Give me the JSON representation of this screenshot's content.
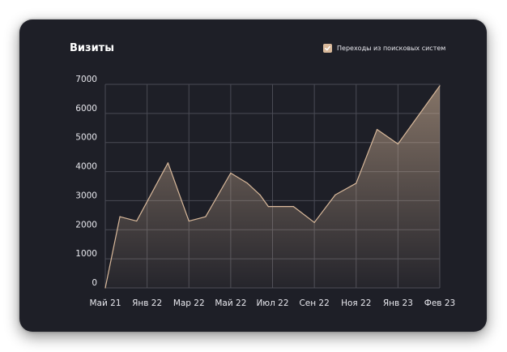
{
  "chart_data": {
    "type": "area",
    "title": "Визиты",
    "xlabel": "",
    "ylabel": "",
    "ylim": [
      0,
      7000
    ],
    "y_ticks": [
      0,
      1000,
      2000,
      3000,
      4000,
      5000,
      6000,
      7000
    ],
    "grid": true,
    "legend_placement": "top-right",
    "categories": [
      "Май 21",
      "Янв 22",
      "Мар 22",
      "Май 22",
      "Июл 22",
      "Сен 22",
      "Ноя 22",
      "Янв 23",
      "Фев 23"
    ],
    "series": [
      {
        "name": "Переходы из поисковых систем",
        "color": "#d9b99b",
        "points": [
          [
            0.0,
            0
          ],
          [
            0.35,
            2450
          ],
          [
            0.75,
            2300
          ],
          [
            1.5,
            4300
          ],
          [
            2.0,
            2300
          ],
          [
            2.4,
            2450
          ],
          [
            3.0,
            3950
          ],
          [
            3.4,
            3600
          ],
          [
            3.7,
            3200
          ],
          [
            3.9,
            2800
          ],
          [
            4.5,
            2800
          ],
          [
            5.0,
            2250
          ],
          [
            5.5,
            3200
          ],
          [
            6.0,
            3600
          ],
          [
            6.5,
            5450
          ],
          [
            7.0,
            4950
          ],
          [
            8.0,
            6950
          ]
        ]
      }
    ]
  },
  "colors": {
    "background": "#1e1f27",
    "grid": "#4a4b55",
    "accent": "#d9b99b"
  },
  "icons": {
    "legend_check": "check-icon"
  }
}
